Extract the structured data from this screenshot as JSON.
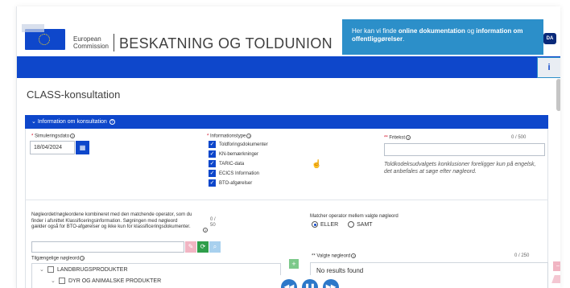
{
  "header": {
    "brand_line1": "European",
    "brand_line2": "Commission",
    "title": "BESKATNING OG TOLDUNION"
  },
  "help_bubble": {
    "text_pre": "Her kan vi finde ",
    "bold1": "online dokumentation",
    "text_mid": " og ",
    "bold2": "information om offentliggørelser",
    "text_end": "."
  },
  "language_badge": "DA",
  "info_button_icon": "info-icon",
  "page_title": "CLASS-konsultation",
  "section": {
    "title": "Information om konsultation",
    "help_icon": "question-icon"
  },
  "simulation_date": {
    "label": "Simuleringsdato",
    "value": "18/04/2024"
  },
  "information_type": {
    "label": "Informationstype",
    "options": [
      {
        "label": "Toldforingsdokumenter",
        "checked": true
      },
      {
        "label": "KN-bemærkninger",
        "checked": true
      },
      {
        "label": "TARIC-data",
        "checked": true
      },
      {
        "label": "ECICS Information",
        "checked": true
      },
      {
        "label": "BTO-afgørelser",
        "checked": true
      }
    ]
  },
  "free_text": {
    "label": "Fritekst",
    "count": "0 / 500",
    "note": "Toldkodeksudvalgets konklusioner foreligger kun på engelsk, det anbefales at søge efter nøgleord."
  },
  "keywords": {
    "description": "Nøgleordet/nøgleordene kombineret med den matchende operator, som du finder i afsnittet Klassificeringsinformation. Søgningen med nøgleord gælder også for BTO-afgørelser og ikke kun for klassificeringsdokumenter.",
    "count_top": "0 /",
    "count_bottom": "50"
  },
  "operator": {
    "label": "Matcher operator mellem valgte nøgleord",
    "options": [
      {
        "label": "ELLER",
        "selected": true
      },
      {
        "label": "SAMT",
        "selected": false
      }
    ]
  },
  "available_keywords": {
    "label": "Tilgængelige nøgleord",
    "tree": [
      "LANDBRUGSPRODUKTER",
      "DYR OG ANIMALSKE PRODUKTER"
    ]
  },
  "selected_keywords": {
    "label": "Valgte nøgleord",
    "count": "0 / 250",
    "empty_text": "No results found"
  },
  "media_controls": [
    "rewind",
    "pause",
    "forward"
  ],
  "colors": {
    "brand_blue": "#0e47cb",
    "bubble_blue": "#2c8fc9",
    "required_red": "#d0021b"
  }
}
